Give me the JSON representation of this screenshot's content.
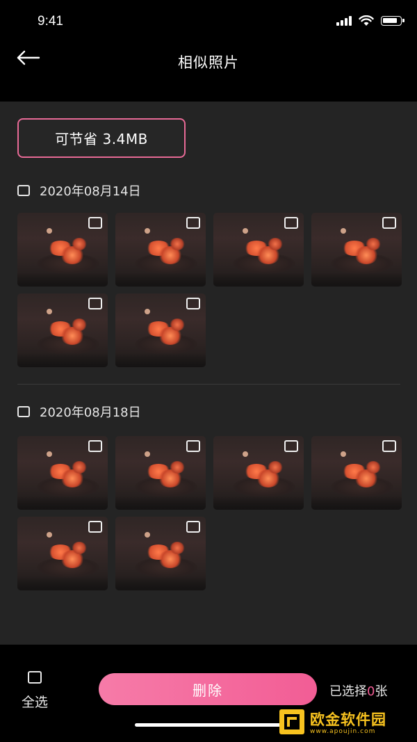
{
  "status_bar": {
    "time": "9:41"
  },
  "header": {
    "title": "相似照片"
  },
  "savings": {
    "label": "可节省 3.4MB"
  },
  "groups": [
    {
      "date": "2020年08月14日",
      "photo_count": 6
    },
    {
      "date": "2020年08月18日",
      "photo_count": 6
    }
  ],
  "footer": {
    "select_all_label": "全选",
    "delete_label": "删除",
    "selected_prefix": "已选择",
    "selected_count": "0",
    "selected_suffix": "张"
  },
  "watermark": {
    "title": "欧金软件园",
    "url": "www.apoujin.com"
  },
  "colors": {
    "accent": "#f25d95",
    "savings_border": "#e86a96",
    "background": "#242424",
    "bar": "#000000",
    "watermark": "#f7c21f"
  },
  "icons": {
    "back": "arrow-left-icon",
    "signal": "signal-icon",
    "wifi": "wifi-icon",
    "battery": "battery-icon",
    "checkbox": "checkbox-icon"
  }
}
